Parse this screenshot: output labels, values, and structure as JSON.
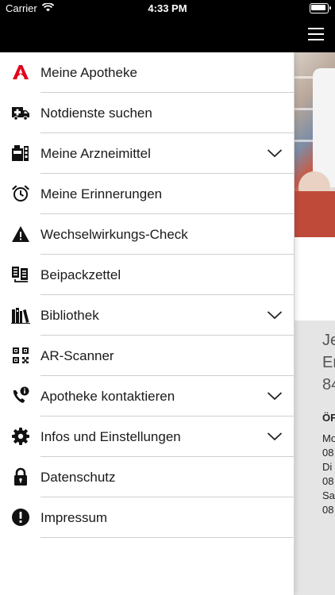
{
  "status_bar": {
    "carrier": "Carrier",
    "time": "4:33 PM"
  },
  "colors": {
    "accent": "#e3001b",
    "bar": "#000000",
    "text": "#1a1a1a"
  },
  "menu": {
    "items": [
      {
        "label": "Meine Apotheke",
        "icon": "pharmacy-a-icon",
        "expandable": false
      },
      {
        "label": "Notdienste suchen",
        "icon": "ambulance-icon",
        "expandable": false
      },
      {
        "label": "Meine Arzneimittel",
        "icon": "medicine-box-icon",
        "expandable": true
      },
      {
        "label": "Meine Erinnerungen",
        "icon": "alarm-clock-icon",
        "expandable": false
      },
      {
        "label": "Wechselwirkungs-Check",
        "icon": "warning-icon",
        "expandable": false
      },
      {
        "label": "Beipackzettel",
        "icon": "leaflet-icon",
        "expandable": false
      },
      {
        "label": "Bibliothek",
        "icon": "books-icon",
        "expandable": true
      },
      {
        "label": "AR-Scanner",
        "icon": "qr-code-icon",
        "expandable": false
      },
      {
        "label": "Apotheke kontaktieren",
        "icon": "phone-info-icon",
        "expandable": true
      },
      {
        "label": "Infos und Einstellungen",
        "icon": "gear-icon",
        "expandable": true
      },
      {
        "label": "Datenschutz",
        "icon": "lock-icon",
        "expandable": false
      },
      {
        "label": "Impressum",
        "icon": "exclamation-icon",
        "expandable": false
      }
    ]
  },
  "background": {
    "lines_large": [
      "Je",
      "Er",
      "84"
    ],
    "heading": "ÖF",
    "lines_small": [
      "Mo",
      "08",
      "Di",
      "08",
      "Sa",
      "08"
    ]
  }
}
